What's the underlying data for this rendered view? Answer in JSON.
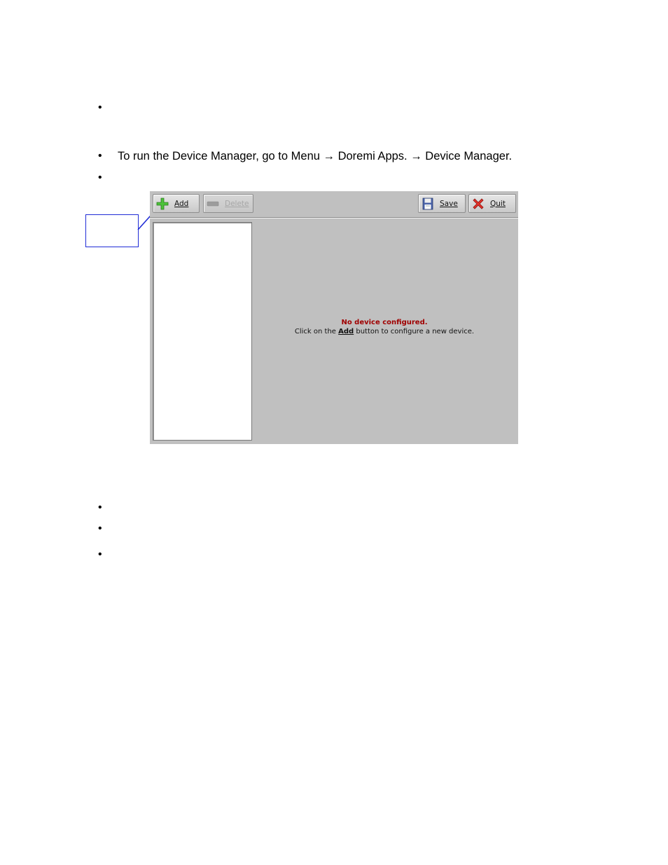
{
  "document": {
    "bullets": [
      {
        "text": ""
      },
      {
        "text": "To run the Device Manager, go to Menu → Doremi Apps. → Device Manager."
      },
      {
        "text": ""
      },
      {
        "text": ""
      },
      {
        "text": ""
      },
      {
        "text": ""
      }
    ]
  },
  "callout": {
    "color": "#1f2bd6"
  },
  "app": {
    "toolbar": {
      "add_label": "Add",
      "delete_label": "Delete",
      "save_label": "Save",
      "quit_label": "Quit"
    },
    "message": {
      "title": "No device configured.",
      "hint_before": "Click on the ",
      "hint_bold": "Add",
      "hint_after": " button to configure a new device."
    },
    "colors": {
      "background": "#c0c0c0",
      "message_title": "#a00000"
    },
    "icons": {
      "add": "green-plus-icon",
      "delete": "minus-icon",
      "save": "floppy-disk-icon",
      "quit": "red-x-icon"
    }
  }
}
